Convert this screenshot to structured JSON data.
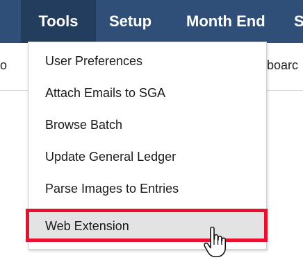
{
  "menubar": {
    "tabs": [
      {
        "label": "Tools"
      },
      {
        "label": "Setup"
      },
      {
        "label": "Month End"
      },
      {
        "label": "S"
      }
    ]
  },
  "subbar": {
    "left_fragment": "o",
    "right_fragment": "boarc"
  },
  "dropdown": {
    "items": [
      {
        "label": "User Preferences"
      },
      {
        "label": "Attach Emails to SGA"
      },
      {
        "label": "Browse Batch"
      },
      {
        "label": "Update General Ledger"
      },
      {
        "label": "Parse Images to Entries"
      },
      {
        "label": "Web Extension"
      }
    ]
  },
  "colors": {
    "menubar": "#2f4f78",
    "active_tab": "#233d5f",
    "hover_item": "#e3e3e3",
    "highlight_box": "#e8102e"
  },
  "icons": {
    "cursor": "hand-pointer-icon"
  }
}
